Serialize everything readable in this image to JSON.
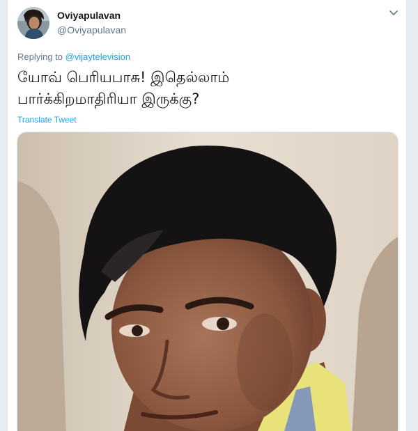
{
  "tweet": {
    "author_name": "Oviyapulavan",
    "author_handle": "@Oviyapulavan",
    "replying_prefix": "Replying to",
    "replying_to": "@vijaytelevision",
    "text": "யோவ் பெரியபாசு! இதெல்லாம்\nபார்க்கிறமாதிரியா இருக்கு?",
    "translate_label": "Translate Tweet"
  },
  "icons": {
    "caret": "chevron-down-icon",
    "avatar": "avatar",
    "media": "meme-photo"
  },
  "colors": {
    "link": "#1da1f2",
    "text": "#14171a",
    "muted": "#657786",
    "border": "#e1e8ed"
  }
}
